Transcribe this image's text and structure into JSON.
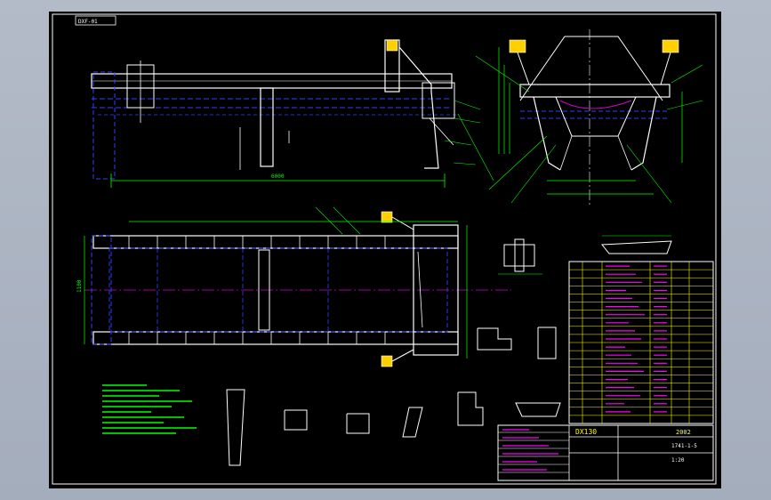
{
  "viewport": {
    "background": "#aab3c1",
    "sheet_background": "#000000"
  },
  "colors": {
    "frame": "#ffffff",
    "outline": "#ffffff",
    "dimension": "#00ff00",
    "hidden": "#3040ff",
    "centerline": "#d000d0",
    "title_block": "#ffff00",
    "annotation_text": "#ff00ff",
    "highlight": "#ffd000"
  },
  "title_tab": {
    "text": "DXF-01"
  },
  "views": [
    {
      "id": "front-elevation",
      "name": "front-view"
    },
    {
      "id": "side-elevation",
      "name": "side-view"
    },
    {
      "id": "plan",
      "name": "plan-view"
    },
    {
      "id": "section-details",
      "name": "section-details"
    }
  ],
  "dimension_labels": {
    "overall_length": "6000",
    "plan_width": "1100"
  },
  "title_block": {
    "title": "DX130",
    "subtitle": "2002",
    "drawing_no": "1741-1-5",
    "scale": "1:20"
  },
  "icons": [
    "lifting-lug-icon",
    "gusset-plate-icon",
    "beam-section-icon"
  ]
}
